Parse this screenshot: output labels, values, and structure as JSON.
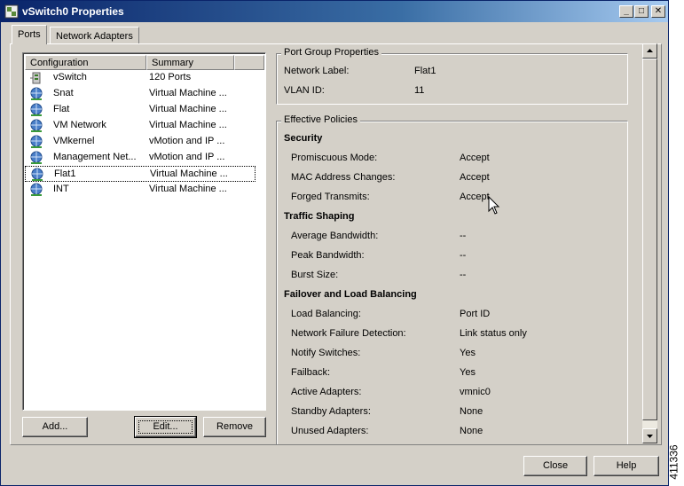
{
  "window": {
    "title": "vSwitch0 Properties",
    "minimize": "_",
    "maximize": "□",
    "close": "✕"
  },
  "tabs": [
    {
      "label": "Ports"
    },
    {
      "label": "Network Adapters"
    }
  ],
  "list": {
    "headers": [
      "Configuration",
      "Summary"
    ],
    "rows": [
      {
        "name": "vSwitch",
        "summary": "120 Ports",
        "icon": "vswitch-icon"
      },
      {
        "name": "Snat",
        "summary": "Virtual Machine ...",
        "icon": "port-group-icon"
      },
      {
        "name": "Flat",
        "summary": "Virtual Machine ...",
        "icon": "port-group-icon"
      },
      {
        "name": "VM Network",
        "summary": "Virtual Machine ...",
        "icon": "port-group-icon"
      },
      {
        "name": "VMkernel",
        "summary": "vMotion and IP ...",
        "icon": "port-group-icon"
      },
      {
        "name": "Management Net...",
        "summary": "vMotion and IP ...",
        "icon": "port-group-icon"
      },
      {
        "name": "Flat1",
        "summary": "Virtual Machine ...",
        "icon": "port-group-icon",
        "selected": true
      },
      {
        "name": "INT",
        "summary": "Virtual Machine ...",
        "icon": "port-group-icon"
      }
    ]
  },
  "buttons": {
    "add": "Add...",
    "edit": "Edit...",
    "remove": "Remove",
    "close": "Close",
    "help": "Help"
  },
  "port_group": {
    "legend": "Port Group Properties",
    "network_label_key": "Network Label:",
    "network_label_value": "Flat1",
    "vlan_key": "VLAN ID:",
    "vlan_value": "11"
  },
  "policies": {
    "legend": "Effective Policies",
    "security": {
      "title": "Security",
      "items": [
        {
          "key": "Promiscuous Mode:",
          "value": "Accept"
        },
        {
          "key": "MAC Address Changes:",
          "value": "Accept"
        },
        {
          "key": "Forged Transmits:",
          "value": "Accept"
        }
      ]
    },
    "traffic": {
      "title": "Traffic Shaping",
      "items": [
        {
          "key": "Average Bandwidth:",
          "value": "--"
        },
        {
          "key": "Peak Bandwidth:",
          "value": "--"
        },
        {
          "key": "Burst Size:",
          "value": "--"
        }
      ]
    },
    "failover": {
      "title": "Failover and Load Balancing",
      "items": [
        {
          "key": "Load Balancing:",
          "value": "Port ID"
        },
        {
          "key": "Network Failure Detection:",
          "value": "Link status only"
        },
        {
          "key": "Notify Switches:",
          "value": "Yes"
        },
        {
          "key": "Failback:",
          "value": "Yes"
        },
        {
          "key": "Active Adapters:",
          "value": "vmnic0"
        },
        {
          "key": "Standby Adapters:",
          "value": "None"
        },
        {
          "key": "Unused Adapters:",
          "value": "None"
        }
      ]
    }
  },
  "side_label": "411336"
}
